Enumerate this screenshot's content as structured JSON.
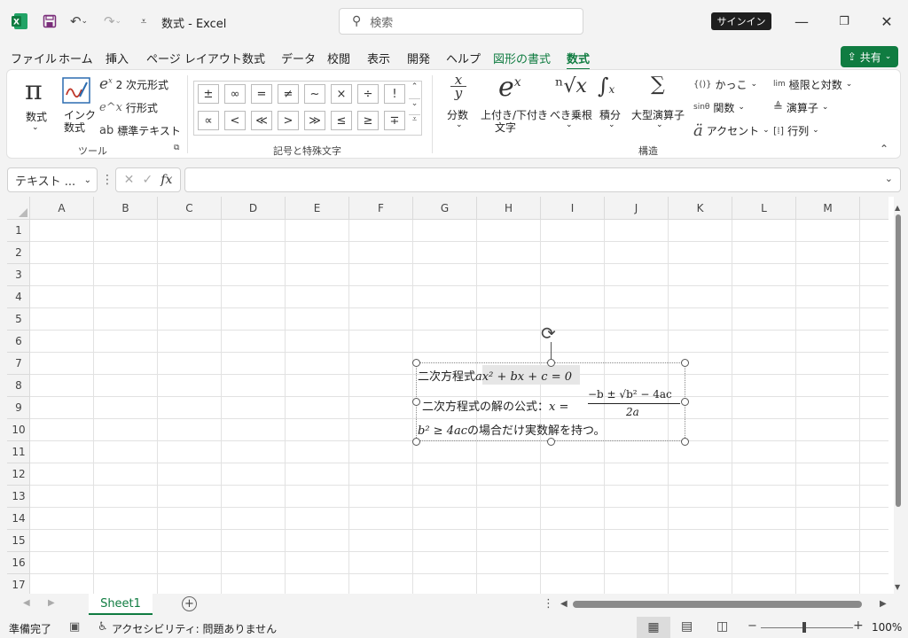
{
  "title_bar": {
    "app_title": "数式  -  Excel",
    "search_placeholder": "検索",
    "signin_label": "サインイン"
  },
  "menu": {
    "tabs": [
      "ファイル",
      "ホーム",
      "挿入",
      "ページ レイアウト",
      "数式",
      "データ",
      "校閲",
      "表示",
      "開発",
      "ヘルプ",
      "図形の書式",
      "数式"
    ],
    "active_tab": "数式",
    "share_label": "共有"
  },
  "ribbon": {
    "tools": {
      "equation_label": "数式",
      "ink_label_1": "インク",
      "ink_label_2": "数式",
      "linear_label": "2 次元形式",
      "professional_label": "行形式",
      "text_label": "標準テキスト",
      "group_caption": "ツール"
    },
    "symbols": {
      "row1": [
        "±",
        "∞",
        "=",
        "≠",
        "~",
        "×",
        "÷",
        "!"
      ],
      "row2": [
        "∝",
        "<",
        "≪",
        ">",
        "≫",
        "≤",
        "≥",
        "∓"
      ],
      "group_caption": "記号と特殊文字"
    },
    "structures": {
      "fraction": "分数",
      "script_1": "上付き/下付き",
      "script_2": "文字",
      "radical": "べき乗根",
      "integral": "積分",
      "large_operator": "大型演算子",
      "bracket": "かっこ",
      "function": "関数",
      "accent": "アクセント",
      "limit_log": "極限と対数",
      "operator": "演算子",
      "matrix": "行列",
      "group_caption": "構造"
    }
  },
  "formula_bar": {
    "name_box": "テキスト ...",
    "fx": "fx"
  },
  "grid": {
    "columns": [
      "A",
      "B",
      "C",
      "D",
      "E",
      "F",
      "G",
      "H",
      "I",
      "J",
      "K",
      "L",
      "M"
    ],
    "rows": [
      "1",
      "2",
      "3",
      "4",
      "5",
      "6",
      "7",
      "8",
      "9",
      "10",
      "11",
      "12",
      "13",
      "14",
      "15",
      "16",
      "17"
    ]
  },
  "equation": {
    "line1_text": "二次方程式",
    "line1_math": "ax² + bx + c = 0",
    "line2_text": "二次方程式の解の公式：",
    "line2_lhs": "x =",
    "line2_num": "−b ± √b² − 4ac",
    "line2_den": "2a",
    "line3_math": "b² ≥ 4ac",
    "line3_text": "の場合だけ実数解を持つ。"
  },
  "sheets": {
    "tabs": [
      "Sheet1"
    ]
  },
  "status": {
    "ready": "準備完了",
    "accessibility": "アクセシビリティ: 問題ありません",
    "zoom": "100%"
  },
  "colors": {
    "accent": "#107c41",
    "signin_bg": "#1f1f1f"
  }
}
